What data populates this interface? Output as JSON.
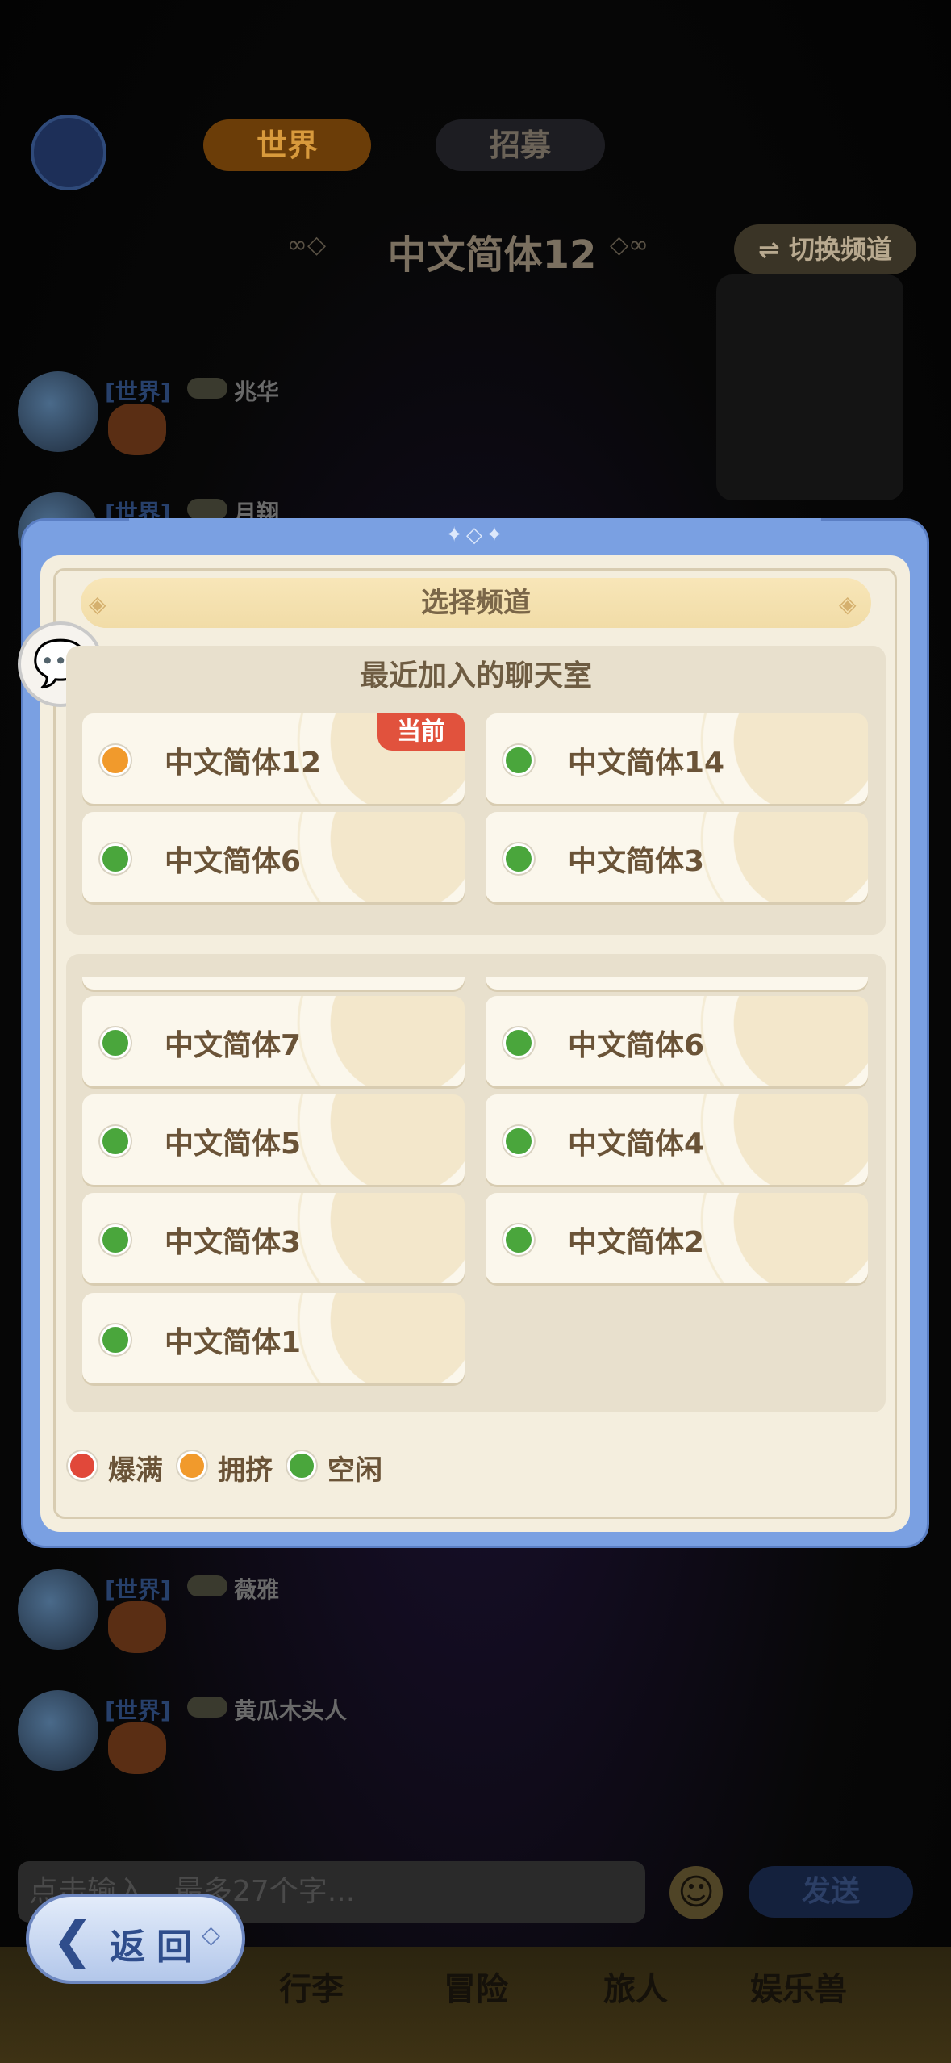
{
  "colors": {
    "full": "#e1483a",
    "crowded": "#f19a2c",
    "idle": "#4aa63c"
  },
  "top": {
    "tabs": [
      "世界",
      "招募"
    ],
    "channel_title": "中文简体12",
    "switch_button": "⇌ 切换频道"
  },
  "chat": {
    "messages": [
      {
        "tag": "[世界]",
        "name": "兆华"
      },
      {
        "tag": "[世界]",
        "name": "月翔"
      },
      {
        "tag": "[世界]",
        "name": "薇雅"
      },
      {
        "tag": "[世界]",
        "name": "黄瓜木头人"
      }
    ],
    "input_placeholder": "点击输入，最多27个字...",
    "send_label": "发送"
  },
  "bottom_nav": [
    "行李",
    "冒险",
    "旅人",
    "娱乐兽"
  ],
  "back_button": "返回",
  "modal": {
    "title": "选择频道",
    "recent_title": "最近加入的聊天室",
    "current_badge": "当前",
    "recent": [
      {
        "label": "中文简体12",
        "status": "crowded",
        "current": true
      },
      {
        "label": "中文简体14",
        "status": "idle"
      },
      {
        "label": "中文简体6",
        "status": "idle"
      },
      {
        "label": "中文简体3",
        "status": "idle"
      }
    ],
    "all": [
      {
        "label": "中文简体7",
        "status": "idle"
      },
      {
        "label": "中文简体6",
        "status": "idle"
      },
      {
        "label": "中文简体5",
        "status": "idle"
      },
      {
        "label": "中文简体4",
        "status": "idle"
      },
      {
        "label": "中文简体3",
        "status": "idle"
      },
      {
        "label": "中文简体2",
        "status": "idle"
      },
      {
        "label": "中文简体1",
        "status": "idle"
      }
    ],
    "legend": [
      {
        "status": "full",
        "label": "爆满"
      },
      {
        "status": "crowded",
        "label": "拥挤"
      },
      {
        "status": "idle",
        "label": "空闲"
      }
    ]
  }
}
